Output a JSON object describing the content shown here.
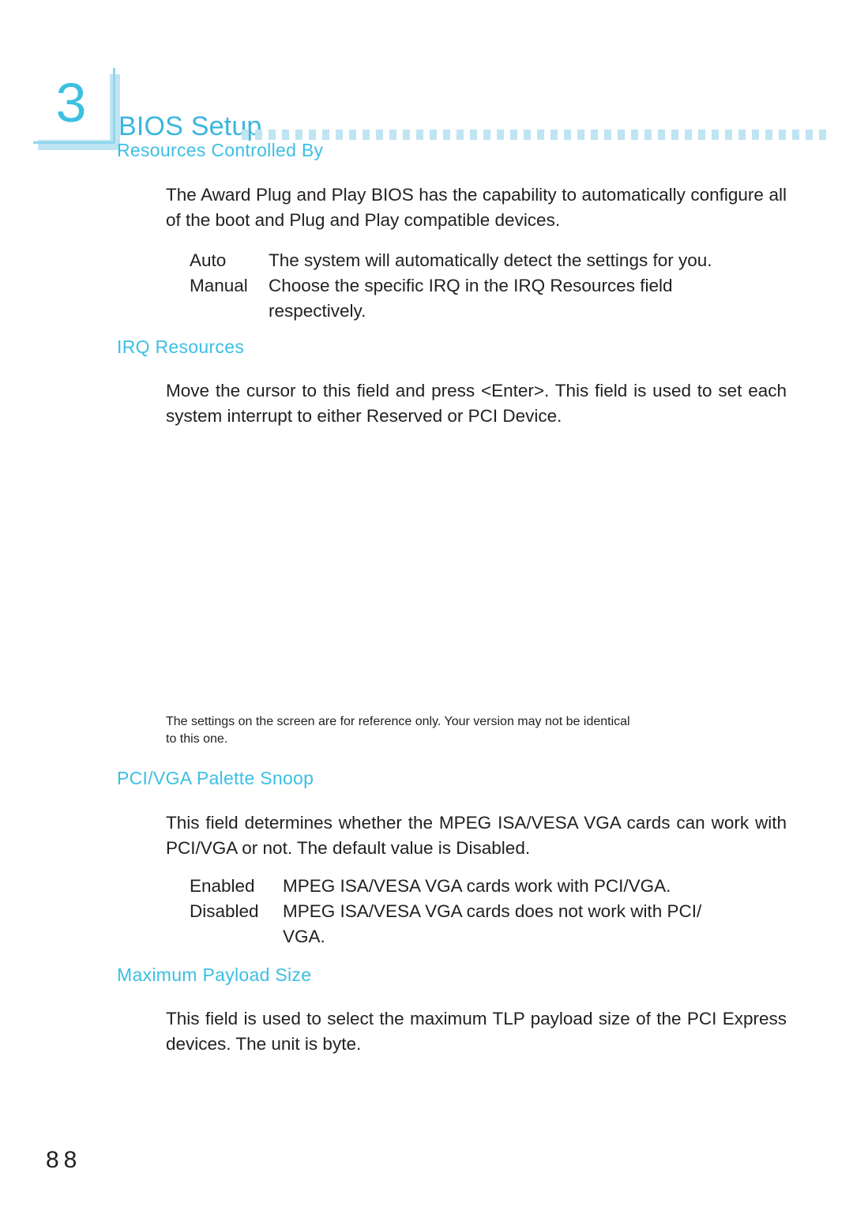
{
  "chapter": {
    "number": "3",
    "title": "BIOS Setup",
    "dot_count": 44
  },
  "page_number": "88",
  "colors": {
    "heading_blue": "#3cbfe4",
    "title_blue": "#3cb6dd",
    "badge_blue": "#3cc0e2",
    "rule_blue": "#8fd6ec",
    "shadow_blue": "#bfe4f2",
    "body_text": "#231f20"
  },
  "sections": [
    {
      "heading": "Resources Controlled By",
      "paragraph": "The Award Plug and Play BIOS has the capability to automatically configure all of the boot and Plug and Play compatible devices.",
      "options": [
        {
          "term": "Auto",
          "desc": "The system will automatically detect the settings for you."
        },
        {
          "term": "Manual",
          "desc": "Choose the specific IRQ in the IRQ Resources field",
          "continuation": "respectively."
        }
      ]
    },
    {
      "heading": "IRQ Resources",
      "paragraph": "Move the cursor to this field and press <Enter>. This field is used to set each system interrupt to either Reserved or PCI Device."
    },
    {
      "heading": "PCI/VGA Palette Snoop",
      "paragraph": "This field determines whether the MPEG ISA/VESA VGA cards can work with PCI/VGA or not. The default value is Disabled.",
      "options": [
        {
          "term": "Enabled",
          "desc": "MPEG ISA/VESA VGA cards work with PCI/VGA."
        },
        {
          "term": "Disabled",
          "desc": "MPEG ISA/VESA VGA cards does not work with PCI/",
          "continuation": "VGA."
        }
      ]
    },
    {
      "heading": "Maximum Payload Size",
      "paragraph": "This field is used to select the maximum TLP payload size of the PCI Express devices. The unit is byte."
    }
  ],
  "note": {
    "line1": "The settings on the screen are for reference only. Your version may not be identical",
    "line2": "to this one."
  }
}
